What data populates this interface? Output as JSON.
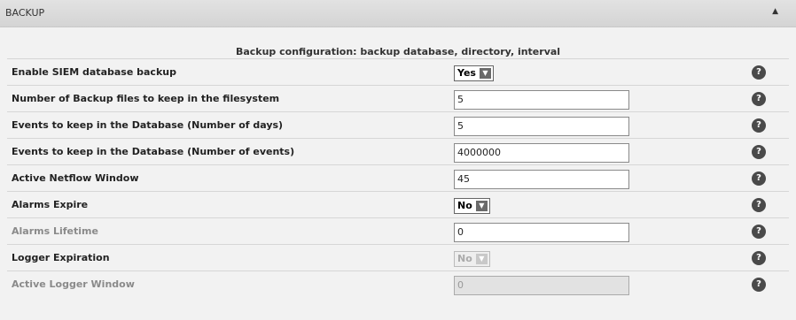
{
  "panel": {
    "title": "BACKUP",
    "collapse_icon": "▲"
  },
  "subtitle": "Backup configuration: backup database, directory, interval",
  "help_glyph": "?",
  "rows": [
    {
      "label": "Enable SIEM database backup",
      "type": "select",
      "value": "Yes",
      "disabled": false
    },
    {
      "label": "Number of Backup files to keep in the filesystem",
      "type": "text",
      "value": "5",
      "disabled": false
    },
    {
      "label": "Events to keep in the Database (Number of days)",
      "type": "text",
      "value": "5",
      "disabled": false
    },
    {
      "label": "Events to keep in the Database (Number of events)",
      "type": "text",
      "value": "4000000",
      "disabled": false
    },
    {
      "label": "Active Netflow Window",
      "type": "text",
      "value": "45",
      "disabled": false
    },
    {
      "label": "Alarms Expire",
      "type": "select",
      "value": "No",
      "disabled": false
    },
    {
      "label": "Alarms Lifetime",
      "type": "text",
      "value": "0",
      "disabled": true,
      "label_muted": true,
      "input_disabled": false
    },
    {
      "label": "Logger Expiration",
      "type": "select",
      "value": "No",
      "disabled": true,
      "label_muted": false
    },
    {
      "label": "Active Logger Window",
      "type": "text",
      "value": "0",
      "disabled": true,
      "label_muted": true,
      "input_disabled": true
    }
  ]
}
